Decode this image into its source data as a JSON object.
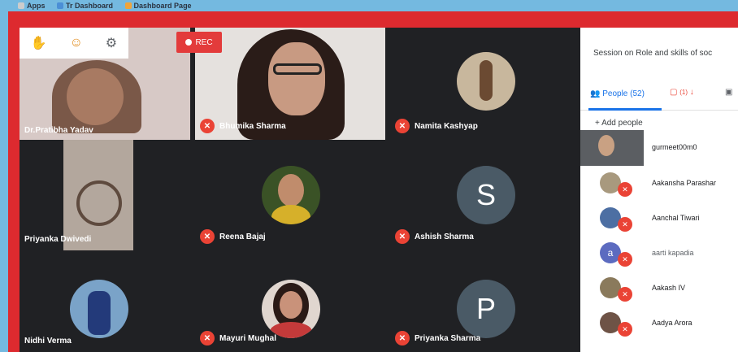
{
  "bookmarks": [
    "Apps",
    "Tr Dashboard",
    "Dashboard Page"
  ],
  "controls": {
    "rec_label": "REC"
  },
  "tiles": [
    {
      "name": "Dr.Pratibha Yadav"
    },
    {
      "name": "Bhumika Sharma"
    },
    {
      "name": "Namita Kashyap"
    },
    {
      "name": "Priyanka Dwivedi"
    },
    {
      "name": "Reena Bajaj"
    },
    {
      "name": "Ashish Sharma",
      "letter": "S"
    },
    {
      "name": "Nidhi Verma"
    },
    {
      "name": "Mayuri Mughal"
    },
    {
      "name": "Priyanka Sharma",
      "letter": "P"
    }
  ],
  "panel": {
    "title": "Session on Role and skills of soc",
    "tab_people": "People (52)",
    "tab_chat_badge": "(1)",
    "add_people": "Add people",
    "people": [
      {
        "name": "gurmeet00m0",
        "has_video": true
      },
      {
        "name": "Aakansha Parashar"
      },
      {
        "name": "Aanchal Tiwari"
      },
      {
        "name": "aarti kapadia",
        "letter": "a"
      },
      {
        "name": "Aakash IV"
      },
      {
        "name": "Aadya Arora"
      }
    ]
  },
  "colors": {
    "accent": "#1a73e8",
    "mic_off": "#ea4335",
    "frame": "#dd2a2f",
    "background": "#74b9e0"
  }
}
